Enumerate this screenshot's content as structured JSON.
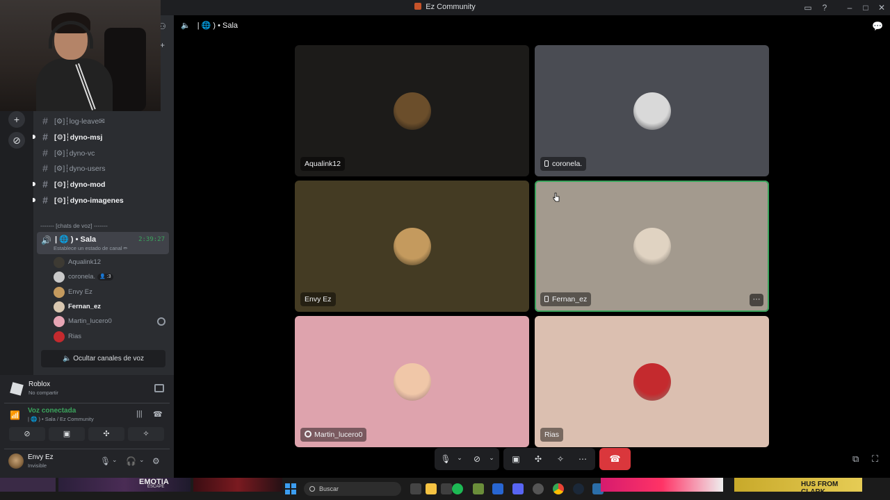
{
  "window": {
    "title": "Ez Community"
  },
  "channels": [
    {
      "label": "[⚙]┆log-leave✉",
      "unread": false
    },
    {
      "label": "[⚙]┆dyno-msj",
      "unread": true
    },
    {
      "label": "[⚙]┆dyno-vc",
      "unread": false
    },
    {
      "label": "[⚙]┆dyno-users",
      "unread": false
    },
    {
      "label": "[⚙]┆dyno-mod",
      "unread": true
    },
    {
      "label": "[⚙]┆dyno-imagenes",
      "unread": true
    }
  ],
  "voice_category": "------- [chats de voz] -------",
  "voice_channel": {
    "name": "| 🌐 ) • Sala",
    "timer": "2:39:27",
    "status_placeholder": "Establece un estado de canal ✏"
  },
  "voice_members": [
    {
      "name": "Aqualink12",
      "bold": false,
      "color": "#3d3a33"
    },
    {
      "name": "coronela.",
      "bold": false,
      "color": "#c9c9c9",
      "badge": "👤 :3"
    },
    {
      "name": "Envy Ez",
      "bold": false,
      "color": "#c49a5e"
    },
    {
      "name": "Fernan_ez",
      "bold": true,
      "color": "#d8c7b0"
    },
    {
      "name": "Martin_lucero0",
      "bold": false,
      "color": "#e7a6b5",
      "xbox": true
    },
    {
      "name": "Rias",
      "bold": false,
      "color": "#c42a2e"
    }
  ],
  "hide_voice_button": "Ocultar canales de voz",
  "activity": {
    "title": "Roblox",
    "subtitle": "No compartir"
  },
  "voice_connection": {
    "title": "Voz conectada",
    "subtitle": "| 🌐 ) • Sala / Ez Community"
  },
  "user": {
    "name": "Envy Ez",
    "status": "Invisible"
  },
  "main_header": {
    "channel": "| 🌐 ) • Sala"
  },
  "tiles": [
    {
      "name": "Aqualink12",
      "bg": "#1c1b19",
      "avatar": "#6b4e2b",
      "icon": ""
    },
    {
      "name": "coronela.",
      "bg": "#4a4c53",
      "avatar": "#d9d9d9",
      "icon": "phone"
    },
    {
      "name": "Envy Ez",
      "bg": "#443b23",
      "avatar": "#c49a5e",
      "icon": ""
    },
    {
      "name": "Fernan_ez",
      "bg": "#a39a8e",
      "avatar": "#e0d3c2",
      "icon": "phone",
      "speaking": true
    },
    {
      "name": "Martin_lucero0",
      "bg": "#dea3ad",
      "avatar": "#f0c7a8",
      "icon": "xbox"
    },
    {
      "name": "Rias",
      "bg": "#dbbfb0",
      "avatar": "#c42a2e",
      "icon": ""
    }
  ],
  "taskbar": {
    "search_placeholder": "Buscar",
    "banner_left": "EMOTIA",
    "banner_left_sub": "ESCAPE",
    "banner_right": "HUS FROM CLARK"
  }
}
